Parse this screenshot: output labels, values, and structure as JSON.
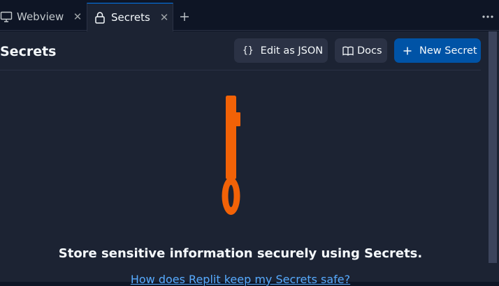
{
  "tabs": [
    {
      "label": "Webview",
      "icon": "monitor-icon"
    },
    {
      "label": "Secrets",
      "icon": "lock-icon"
    }
  ],
  "tab_actions": {
    "add_icon": "plus-icon",
    "more_icon": "ellipsis-icon"
  },
  "header": {
    "title": "Secrets",
    "edit_json_glyph": "{}",
    "edit_json_label": "Edit as JSON",
    "docs_label": "Docs",
    "new_secret_label": "New Secret"
  },
  "empty_state": {
    "illustration": "key-icon",
    "title": "Store sensitive information securely using Secrets.",
    "link": "How does Replit keep my Secrets safe?"
  },
  "colors": {
    "background": "#0e1525",
    "panel": "#1c2333",
    "button": "#2b3245",
    "primary": "#0053a6",
    "accent_orange": "#f26207",
    "link": "#57abff"
  }
}
